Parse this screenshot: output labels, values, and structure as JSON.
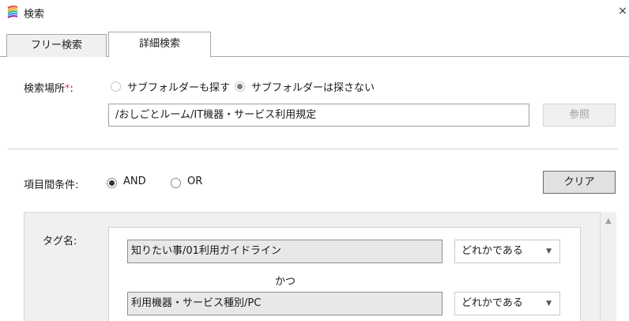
{
  "window": {
    "title": "検索",
    "close_glyph": "×"
  },
  "tabs": [
    {
      "label": "フリー検索",
      "active": false
    },
    {
      "label": "詳細検索",
      "active": true
    }
  ],
  "search_location": {
    "label": "検索場所",
    "required_mark": "*",
    "suffix": ":",
    "options": [
      {
        "label": "サブフォルダーも探す",
        "checked": false,
        "disabled": true
      },
      {
        "label": "サブフォルダーは探さない",
        "checked": true,
        "disabled": true
      }
    ],
    "path_value": "/おしごとルーム/IT機器・サービス利用規定",
    "browse_label": "参照"
  },
  "item_condition": {
    "label": "項目間条件:",
    "options": [
      {
        "label": "AND",
        "checked": true
      },
      {
        "label": "OR",
        "checked": false
      }
    ],
    "clear_label": "クリア"
  },
  "tag_section": {
    "label": "タグ名:",
    "conditions": [
      {
        "value": "知りたい事/01利用ガイドライン",
        "match": "どれかである"
      },
      {
        "value": "利用機器・サービス種別/PC",
        "match": "どれかである"
      }
    ],
    "joiner": "かつ"
  },
  "icons": {
    "app": "color-stripes-icon",
    "close": "close-icon",
    "chevron": "chevron-down-icon",
    "scroll_up": "chevron-up-icon"
  }
}
